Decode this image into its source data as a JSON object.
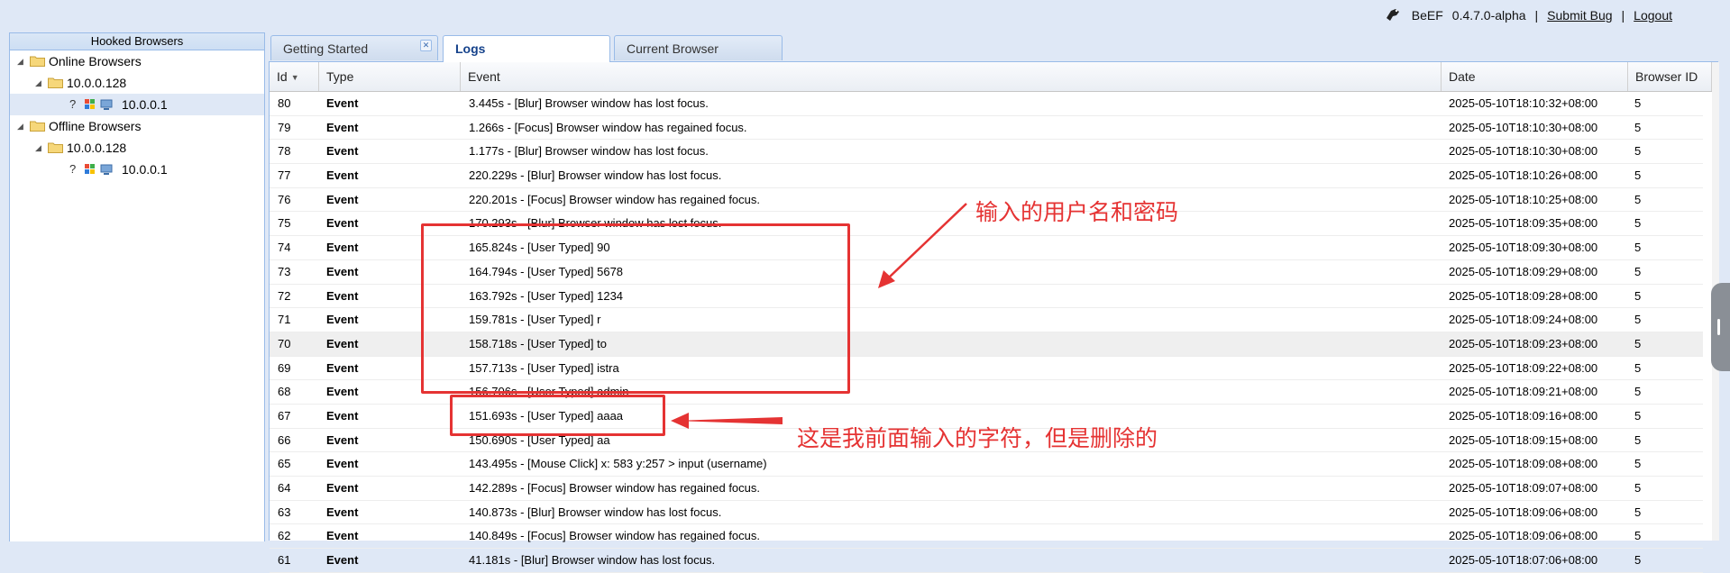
{
  "topbar": {
    "app_name": "BeEF",
    "version": "0.4.7.0-alpha",
    "sep": "|",
    "submit_bug": "Submit  Bug",
    "logout": "Logout"
  },
  "left": {
    "header": "Hooked Browsers",
    "online": "Online Browsers",
    "online_ip": "10.0.0.128",
    "online_host": "10.0.0.1",
    "offline": "Offline Browsers",
    "offline_ip": "10.0.0.128",
    "offline_host": "10.0.0.1",
    "unknown_glyph": "?"
  },
  "tabs": [
    {
      "label": "Getting Started"
    },
    {
      "label": "Logs"
    },
    {
      "label": "Current Browser"
    }
  ],
  "grid": {
    "columns": {
      "id": "Id",
      "type": "Type",
      "event": "Event",
      "date": "Date",
      "bid": "Browser ID"
    },
    "rows": [
      {
        "id": "80",
        "type": "Event",
        "event": "3.445s - [Blur] Browser window has lost focus.",
        "date": "2025-05-10T18:10:32+08:00",
        "bid": "5"
      },
      {
        "id": "79",
        "type": "Event",
        "event": "1.266s - [Focus] Browser window has regained focus.",
        "date": "2025-05-10T18:10:30+08:00",
        "bid": "5"
      },
      {
        "id": "78",
        "type": "Event",
        "event": "1.177s - [Blur] Browser window has lost focus.",
        "date": "2025-05-10T18:10:30+08:00",
        "bid": "5"
      },
      {
        "id": "77",
        "type": "Event",
        "event": "220.229s - [Blur] Browser window has lost focus.",
        "date": "2025-05-10T18:10:26+08:00",
        "bid": "5"
      },
      {
        "id": "76",
        "type": "Event",
        "event": "220.201s - [Focus] Browser window has regained focus.",
        "date": "2025-05-10T18:10:25+08:00",
        "bid": "5"
      },
      {
        "id": "75",
        "type": "Event",
        "event": "170.293s - [Blur] Browser window has lost focus.",
        "date": "2025-05-10T18:09:35+08:00",
        "bid": "5"
      },
      {
        "id": "74",
        "type": "Event",
        "event": "165.824s - [User Typed] 90",
        "date": "2025-05-10T18:09:30+08:00",
        "bid": "5"
      },
      {
        "id": "73",
        "type": "Event",
        "event": "164.794s - [User Typed] 5678",
        "date": "2025-05-10T18:09:29+08:00",
        "bid": "5"
      },
      {
        "id": "72",
        "type": "Event",
        "event": "163.792s - [User Typed] 1234",
        "date": "2025-05-10T18:09:28+08:00",
        "bid": "5"
      },
      {
        "id": "71",
        "type": "Event",
        "event": "159.781s - [User Typed] r",
        "date": "2025-05-10T18:09:24+08:00",
        "bid": "5"
      },
      {
        "id": "70",
        "type": "Event",
        "event": "158.718s - [User Typed] to",
        "date": "2025-05-10T18:09:23+08:00",
        "bid": "5"
      },
      {
        "id": "69",
        "type": "Event",
        "event": "157.713s - [User Typed] istra",
        "date": "2025-05-10T18:09:22+08:00",
        "bid": "5"
      },
      {
        "id": "68",
        "type": "Event",
        "event": "156.706s - [User Typed] admin",
        "date": "2025-05-10T18:09:21+08:00",
        "bid": "5"
      },
      {
        "id": "67",
        "type": "Event",
        "event": "151.693s - [User Typed] aaaa",
        "date": "2025-05-10T18:09:16+08:00",
        "bid": "5"
      },
      {
        "id": "66",
        "type": "Event",
        "event": "150.690s - [User Typed] aa",
        "date": "2025-05-10T18:09:15+08:00",
        "bid": "5"
      },
      {
        "id": "65",
        "type": "Event",
        "event": "143.495s - [Mouse Click] x: 583 y:257 > input (username)",
        "date": "2025-05-10T18:09:08+08:00",
        "bid": "5"
      },
      {
        "id": "64",
        "type": "Event",
        "event": "142.289s - [Focus] Browser window has regained focus.",
        "date": "2025-05-10T18:09:07+08:00",
        "bid": "5"
      },
      {
        "id": "63",
        "type": "Event",
        "event": "140.873s - [Blur] Browser window has lost focus.",
        "date": "2025-05-10T18:09:06+08:00",
        "bid": "5"
      },
      {
        "id": "62",
        "type": "Event",
        "event": "140.849s - [Focus] Browser window has regained focus.",
        "date": "2025-05-10T18:09:06+08:00",
        "bid": "5"
      },
      {
        "id": "61",
        "type": "Event",
        "event": "41.181s - [Blur] Browser window has lost focus.",
        "date": "2025-05-10T18:07:06+08:00",
        "bid": "5"
      }
    ]
  },
  "annotations": {
    "label1": "输入的用户名和密码",
    "label2": "这是我前面输入的字符，但是删除的"
  },
  "colors": {
    "annotation": "#e53333",
    "panel_border": "#99bbe8",
    "background": "#dfe8f6"
  }
}
